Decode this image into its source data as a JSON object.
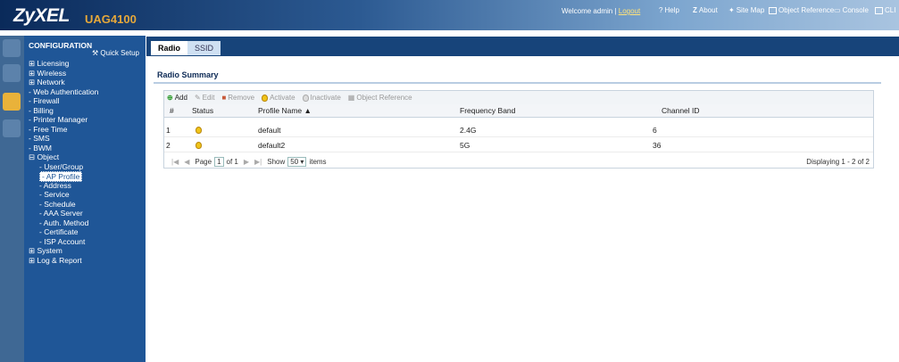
{
  "header": {
    "brand": "ZyXEL",
    "model": "UAG4100",
    "welcome": "Welcome admin |",
    "logout": "Logout",
    "links": [
      {
        "label": "Help",
        "icon": "help-icon"
      },
      {
        "label": "About",
        "icon": "about-icon"
      },
      {
        "label": "Site Map",
        "icon": "sitemap-icon"
      },
      {
        "label": "Object Reference",
        "icon": "object-reference-icon"
      },
      {
        "label": "Console",
        "icon": "console-icon"
      },
      {
        "label": "CLI",
        "icon": "cli-icon"
      }
    ]
  },
  "nav": {
    "title": "CONFIGURATION",
    "quick_setup": "Quick Setup",
    "items": [
      {
        "label": "Licensing",
        "prefix": "⊞"
      },
      {
        "label": "Wireless",
        "prefix": "⊞"
      },
      {
        "label": "Network",
        "prefix": "⊞"
      },
      {
        "label": "Web Authentication",
        "prefix": "-"
      },
      {
        "label": "Firewall",
        "prefix": "-"
      },
      {
        "label": "Billing",
        "prefix": "-"
      },
      {
        "label": "Printer Manager",
        "prefix": "-"
      },
      {
        "label": "Free Time",
        "prefix": "-"
      },
      {
        "label": "SMS",
        "prefix": "-"
      },
      {
        "label": "BWM",
        "prefix": "-"
      },
      {
        "label": "Object",
        "prefix": "⊟"
      },
      {
        "label": "User/Group",
        "prefix": "-"
      },
      {
        "label": "AP Profile",
        "prefix": "-"
      },
      {
        "label": "Address",
        "prefix": "-"
      },
      {
        "label": "Service",
        "prefix": "-"
      },
      {
        "label": "Schedule",
        "prefix": "-"
      },
      {
        "label": "AAA Server",
        "prefix": "-"
      },
      {
        "label": "Auth. Method",
        "prefix": "-"
      },
      {
        "label": "Certificate",
        "prefix": "-"
      },
      {
        "label": "ISP Account",
        "prefix": "-"
      },
      {
        "label": "System",
        "prefix": "⊞"
      },
      {
        "label": "Log & Report",
        "prefix": "⊞"
      }
    ]
  },
  "tabs": [
    "Radio",
    "SSID"
  ],
  "section_title": "Radio Summary",
  "toolbar": {
    "add": "Add",
    "edit": "Edit",
    "remove": "Remove",
    "activate": "Activate",
    "inactivate": "Inactivate",
    "object_reference": "Object Reference"
  },
  "table": {
    "columns": [
      "#",
      "Status",
      "Profile Name ▲",
      "Frequency Band",
      "Channel ID"
    ],
    "rows": [
      {
        "num": "1",
        "profile": "default",
        "band": "2.4G",
        "channel": "6"
      },
      {
        "num": "2",
        "profile": "default2",
        "band": "5G",
        "channel": "36"
      }
    ]
  },
  "pager": {
    "page_label": "Page",
    "page_value": "1",
    "of": "of 1",
    "show": "Show",
    "show_value": "50",
    "items": "items",
    "displaying": "Displaying 1 - 2 of 2"
  },
  "colors": {
    "accent": "#1f5697",
    "status_active": "#f0c419"
  }
}
